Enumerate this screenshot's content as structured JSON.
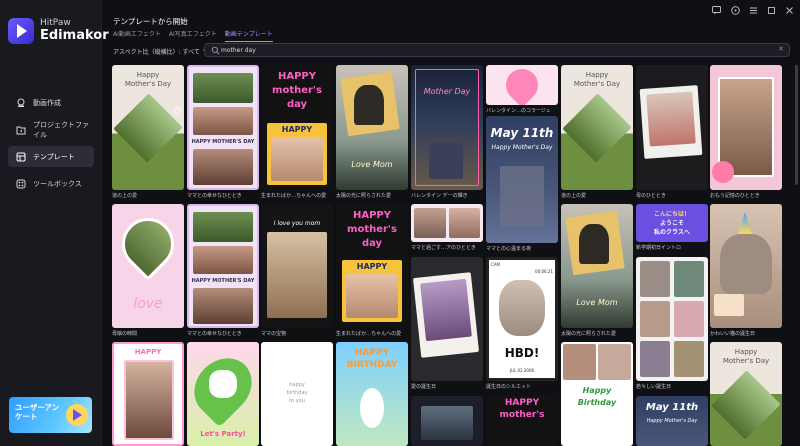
{
  "app": {
    "brand": "HitPaw",
    "product": "Edimakor"
  },
  "sidebar": {
    "items": [
      {
        "label": "動画作成",
        "icon": "video-create-icon"
      },
      {
        "label": "プロジェクトファイル",
        "icon": "folder-icon"
      },
      {
        "label": "テンプレート",
        "icon": "template-icon"
      },
      {
        "label": "ツールボックス",
        "icon": "toolbox-icon"
      }
    ],
    "survey": "ユーザーアンケート"
  },
  "header": {
    "title": "テンプレートから開始",
    "tabs": [
      "AI動画エフェクト",
      "AI写真エフェクト",
      "動画テンプレート"
    ],
    "ratio_label": "アスペクト比（縦横比）: すべて"
  },
  "search": {
    "value": "mother day"
  },
  "cards": {
    "c1": {
      "label": "道の上の愛",
      "t1": "Happy",
      "t2": "Mother's Day"
    },
    "c2": {
      "label": "ママとの幸せなひととき",
      "t1": "HAPPY MOTHER'S DAY"
    },
    "c3": {
      "label": "生まれたばか…ちゃんへの愛",
      "t1": "HAPPY",
      "t2": "mother's",
      "t3": "day",
      "t4": "HAPPY"
    },
    "c4": {
      "label": "太陽の光に照らされた愛",
      "t1": "Love Mom"
    },
    "c5": {
      "label": "バレンタイン デーの輝き",
      "t1": "Mother Day"
    },
    "c6": {
      "label": "バレンタイン…のコラージュ"
    },
    "c6b": {
      "label": "ママとの心温まる夜",
      "t1": "May 11th",
      "t2": "Happy Mother's Day"
    },
    "c7": {
      "label": "道の上の愛",
      "t1": "Happy",
      "t2": "Mother's Day"
    },
    "c8": {
      "label": "母のひととき"
    },
    "c9": {
      "label": "おもう記憶のひととき"
    },
    "r2c1": {
      "label": "母娘の時間",
      "t1": "love"
    },
    "r2c2": {
      "label": "ママとの幸せなひととき",
      "t1": "HAPPY MOTHER'S DAY"
    },
    "r2c3": {
      "label": "ママの宝物",
      "t1": "I love you mom"
    },
    "r2c4": {
      "label": "生まれたばか…ちゃんへの愛",
      "t1": "HAPPY",
      "t2": "mother's",
      "t3": "day",
      "t4": "HAPPY"
    },
    "r2c5": {
      "label": "ママと過ごす…アのひととき"
    },
    "r2c5b": {
      "label": "愛の誕生日"
    },
    "r2c6": {
      "label": "誕生日のシルエット",
      "t1": "CAM",
      "t2": "00:06:21",
      "t3": "HBD!",
      "t4": "JUL 02 2006"
    },
    "r2c7": {
      "label": "太陽の光に照らされた愛",
      "t1": "Love Mom"
    },
    "r2c8a": {
      "label": "新学期初日イントロ",
      "t1": "こんにちは！",
      "t2": "ようこそ",
      "t3": "私のクラスへ"
    },
    "r2c8b": {
      "label": "若々しい誕生日"
    },
    "r2c9": {
      "label": "かわいい猫の誕生日"
    },
    "r3c1": {
      "t1": "HAPPY"
    },
    "r3c2": {
      "t1": "Let's Party!"
    },
    "r3c3": {
      "t1": "happy",
      "t2": "birthday",
      "t3": "to you"
    },
    "r3c4": {
      "t1": "HAPPY",
      "t2": "BIRTHDAY"
    },
    "r3c6": {
      "t1": "HAPPY",
      "t2": "mother's"
    },
    "r3c7": {
      "t1": "Happy",
      "t2": "Birthday"
    },
    "r3c8": {
      "t1": "May 11th",
      "t2": "Happy Mother's Day"
    },
    "r3c9": {
      "t1": "Happy",
      "t2": "Mother's Day"
    }
  }
}
